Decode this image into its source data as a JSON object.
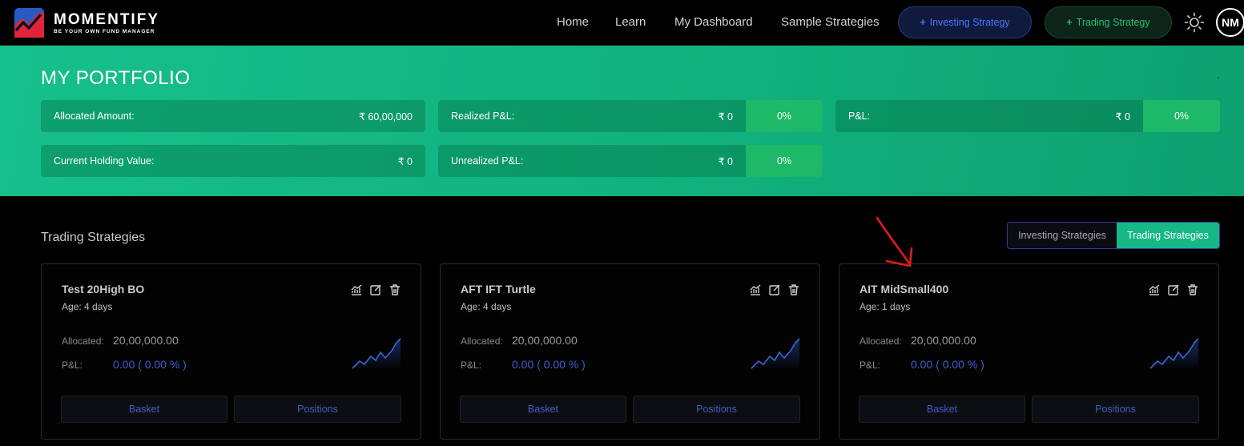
{
  "brand": {
    "name": "MOMENTIFY",
    "tagline": "BE YOUR OWN FUND MANAGER",
    "colors": {
      "accent_green": "#16c08a",
      "accent_blue": "#4b74ff",
      "logo_red": "#e0243a",
      "logo_blue": "#2b59c3"
    }
  },
  "nav": {
    "links": [
      "Home",
      "Learn",
      "My Dashboard",
      "Sample Strategies"
    ],
    "investing_button": "Investing Strategy",
    "trading_button": "Trading Strategy",
    "plus": "+",
    "theme_icon": "sun-icon",
    "avatar_initials": "NM"
  },
  "portfolio": {
    "title": "MY PORTFOLIO",
    "allocated": {
      "label": "Allocated Amount:",
      "value": "₹ 60,00,000"
    },
    "current_holding": {
      "label": "Current Holding Value:",
      "value": "₹ 0"
    },
    "realized": {
      "label": "Realized P&L:",
      "value": "₹ 0",
      "pct": "0%"
    },
    "unrealized": {
      "label": "Unrealized P&L:",
      "value": "₹ 0",
      "pct": "0%"
    },
    "pnl": {
      "label": "P&L:",
      "value": "₹ 0",
      "pct": "0%"
    }
  },
  "section": {
    "title": "Trading Strategies",
    "toggle": {
      "investing": "Investing Strategies",
      "trading": "Trading Strategies",
      "active": "trading"
    }
  },
  "cards": [
    {
      "name": "Test 20High BO",
      "age": "Age: 4 days",
      "allocated_label": "Allocated:",
      "allocated": "20,00,000.00",
      "pnl_label": "P&L:",
      "pnl": "0.00 ( 0.00 % )",
      "basket": "Basket",
      "positions": "Positions"
    },
    {
      "name": "AFT IFT Turtle",
      "age": "Age: 4 days",
      "allocated_label": "Allocated:",
      "allocated": "20,00,000.00",
      "pnl_label": "P&L:",
      "pnl": "0.00 ( 0.00 % )",
      "basket": "Basket",
      "positions": "Positions"
    },
    {
      "name": "AIT MidSmall400",
      "age": "Age: 1 days",
      "allocated_label": "Allocated:",
      "allocated": "20,00,000.00",
      "pnl_label": "P&L:",
      "pnl": "0.00 ( 0.00 % )",
      "basket": "Basket",
      "positions": "Positions"
    }
  ],
  "card_icons": [
    "chart-icon",
    "edit-icon",
    "delete-icon"
  ],
  "annotation": {
    "type": "red-arrow",
    "color": "#e01b1b"
  }
}
